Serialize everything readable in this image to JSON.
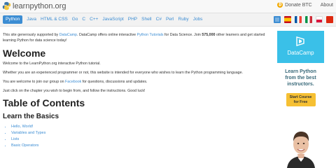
{
  "header": {
    "logo_text": "learnpython.org",
    "donate_label": "Donate BTC",
    "about_label": "About"
  },
  "nav": {
    "items": [
      "Python",
      "Java",
      "HTML & CSS",
      "Go",
      "C",
      "C++",
      "JavaScript",
      "PHP",
      "Shell",
      "C#",
      "Perl",
      "Ruby",
      "Jobs"
    ],
    "active": "Python"
  },
  "languages": [
    "en",
    "es",
    "fr",
    "it",
    "pl",
    "cn"
  ],
  "sponsor": {
    "prefix": "This site generously supported by ",
    "link1": "DataCamp",
    "middle": ". DataCamp offers online interactive ",
    "link2": "Python Tutorials",
    "middle2": " for Data Science. Join ",
    "count": "575,000",
    "suffix": " other learners and get started learning Python for data science today!"
  },
  "welcome": {
    "title": "Welcome",
    "intro": "Welcome to the LearnPython.org interactive Python tutorial.",
    "para2": "Whether you are an experienced programmer or not, this website is intended for everyone who wishes to learn the Python programming language.",
    "para3_prefix": "You are welcome to join our group on ",
    "para3_link": "Facebook",
    "para3_suffix": " for questions, discussions and updates.",
    "para4": "Just click on the chapter you wish to begin from, and follow the instructions. Good luck!"
  },
  "toc": {
    "title": "Table of Contents",
    "section": "Learn the Basics",
    "items": [
      "Hello, World!",
      "Variables and Types",
      "Lists",
      "Basic Operators"
    ]
  },
  "sidebar": {
    "brand": "DataCamp",
    "headline_line1": "Learn Python",
    "headline_line2": "from the best",
    "headline_line3": "instructors.",
    "cta_line1": "Start Course",
    "cta_line2": "for Free"
  },
  "colors": {
    "accent": "#3c8dd3",
    "datacamp": "#3ac0e8",
    "cta": "#f6c033"
  }
}
